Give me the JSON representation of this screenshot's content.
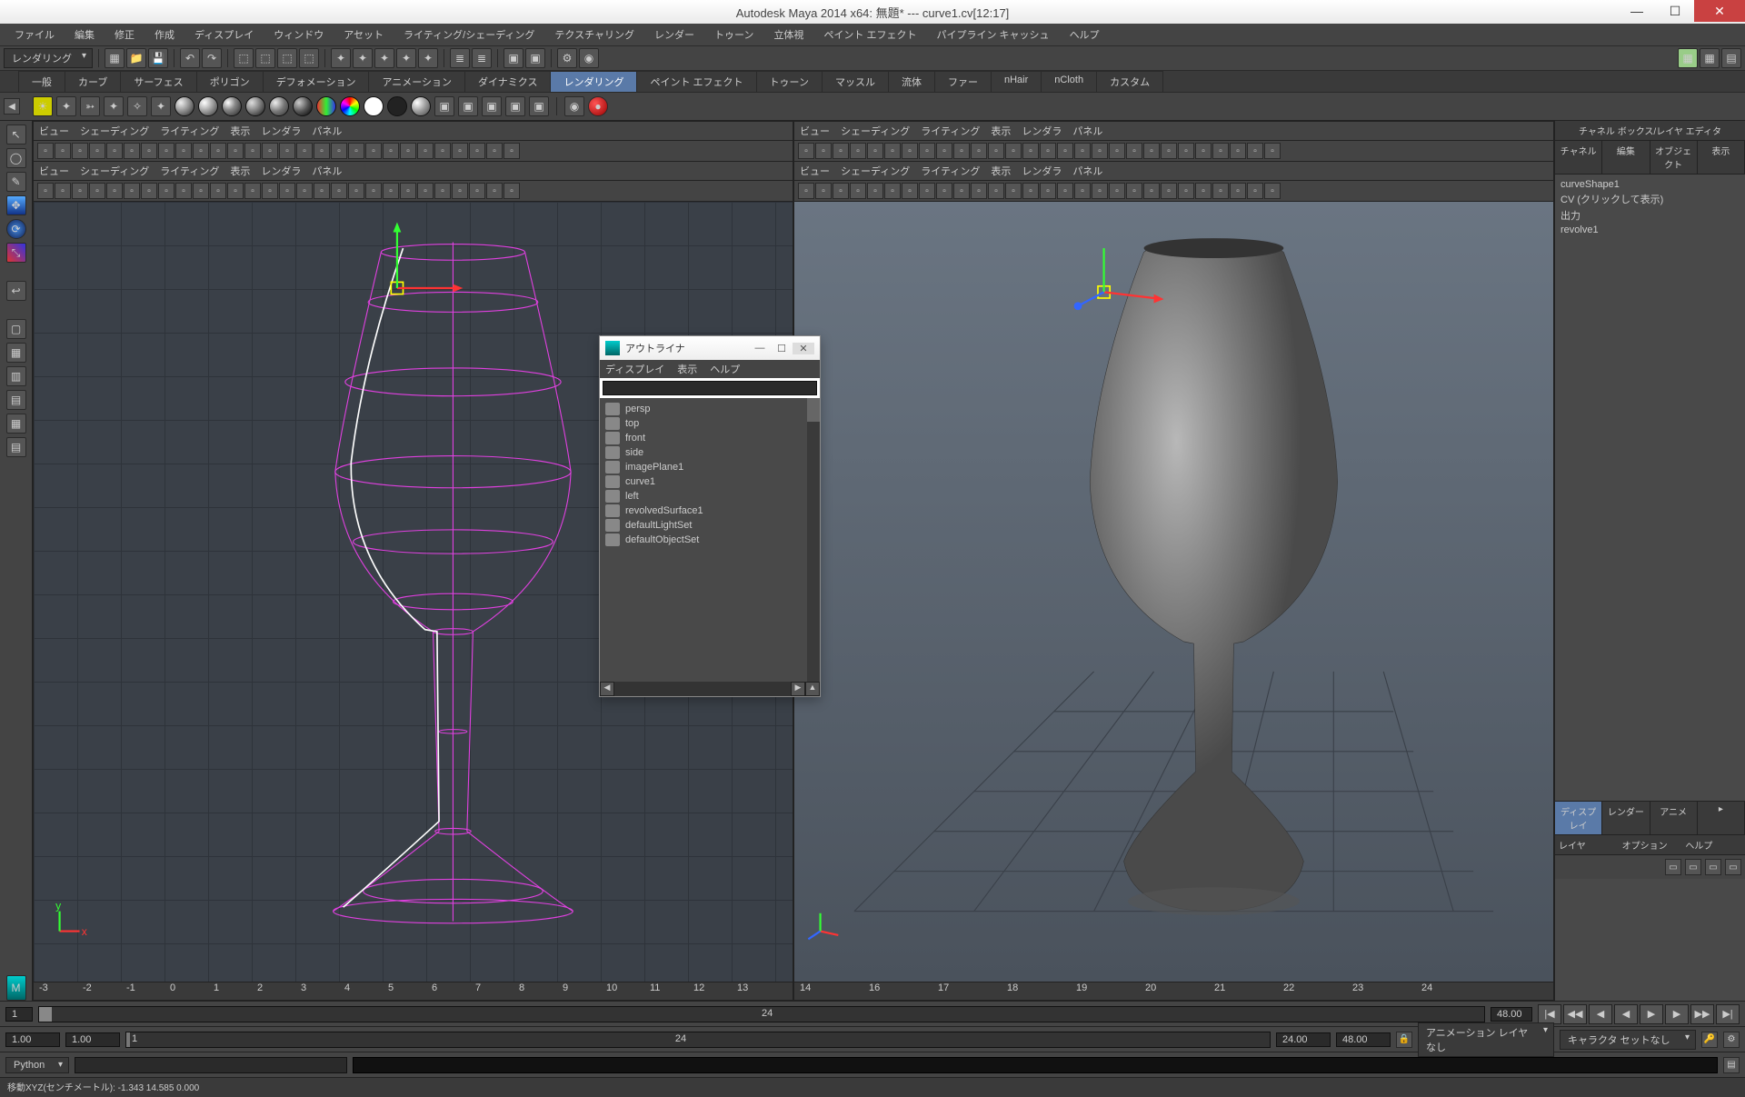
{
  "window": {
    "title": "Autodesk Maya 2014 x64: 無題*  ---  curve1.cv[12:17]",
    "min": "—",
    "max": "☐",
    "close": "✕"
  },
  "menu": [
    "ファイル",
    "編集",
    "修正",
    "作成",
    "ディスプレイ",
    "ウィンドウ",
    "アセット",
    "ライティング/シェーディング",
    "テクスチャリング",
    "レンダー",
    "トゥーン",
    "立体視",
    "ペイント エフェクト",
    "パイプライン キャッシュ",
    "ヘルプ"
  ],
  "mode_dropdown": "レンダリング",
  "shelfTabs": [
    "一般",
    "カーブ",
    "サーフェス",
    "ポリゴン",
    "デフォメーション",
    "アニメーション",
    "ダイナミクス",
    "レンダリング",
    "ペイント エフェクト",
    "トゥーン",
    "マッスル",
    "流体",
    "ファー",
    "nHair",
    "nCloth",
    "カスタム"
  ],
  "activeShelfTab": "レンダリング",
  "vpMenus": [
    "ビュー",
    "シェーディング",
    "ライティング",
    "表示",
    "レンダラ",
    "パネル"
  ],
  "channelBox": {
    "title": "チャネル ボックス/レイヤ エディタ",
    "tabs": [
      "チャネル",
      "編集",
      "オブジェクト",
      "表示"
    ],
    "items": [
      "curveShape1",
      "CV (クリックして表示)",
      "出力",
      "  revolve1"
    ]
  },
  "layerPanel": {
    "tabs": [
      "ディスプレイ",
      "レンダー",
      "アニメ"
    ],
    "menu": [
      "レイヤ",
      "オプション",
      "ヘルプ"
    ]
  },
  "outliner": {
    "title": "アウトライナ",
    "menu": [
      "ディスプレイ",
      "表示",
      "ヘルプ"
    ],
    "items": [
      {
        "label": "persp",
        "dim": true
      },
      {
        "label": "top",
        "dim": true
      },
      {
        "label": "front",
        "dim": false
      },
      {
        "label": "side",
        "dim": true
      },
      {
        "label": "imagePlane1",
        "dim": false
      },
      {
        "label": "curve1",
        "dim": false
      },
      {
        "label": "left",
        "dim": true
      },
      {
        "label": "revolvedSurface1",
        "dim": false
      },
      {
        "label": "defaultLightSet",
        "dim": false
      },
      {
        "label": "defaultObjectSet",
        "dim": false
      }
    ]
  },
  "timeline": {
    "start1": "1",
    "start2": "1",
    "frame": "1",
    "mid": "24",
    "end1": "24.00",
    "end2": "48.00",
    "animLayer": "アニメーション レイヤなし",
    "charSet": "キャラクタ セットなし"
  },
  "range": {
    "start": "1.00",
    "end": "1.00",
    "cmd": "Python"
  },
  "helpline": "移動XYZ(センチメートル):   -1.343     14.585     0.000",
  "ruler_left": [
    "-3",
    "-2",
    "-1",
    "0",
    "1",
    "2",
    "3",
    "4",
    "5",
    "6",
    "7",
    "8",
    "9",
    "10",
    "11",
    "12",
    "13"
  ],
  "ruler_right": [
    "14",
    "16",
    "17",
    "18",
    "19",
    "20",
    "21",
    "22",
    "23",
    "24"
  ]
}
